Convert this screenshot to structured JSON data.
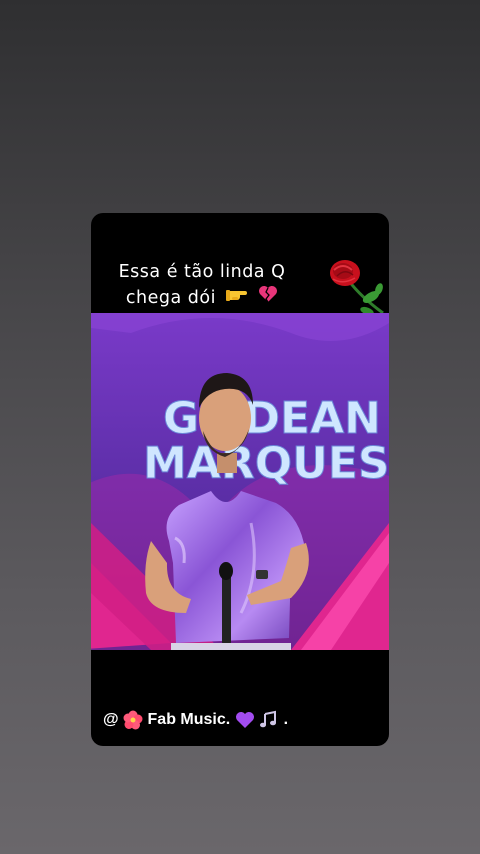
{
  "story": {
    "caption_line1": "Essa é tão linda Q",
    "caption_line2": "chega dói",
    "caption_emojis": [
      "pointing-hand-icon",
      "broken-heart-icon"
    ],
    "sticker": "rose-icon",
    "video_stage_text": [
      "GILDEAN",
      "MARQUES"
    ],
    "footer_at": "@",
    "footer_name": "Fab Music.",
    "footer_suffix": ".",
    "footer_emojis": [
      "hibiscus-icon",
      "purple-heart-icon",
      "music-notes-icon"
    ]
  },
  "colors": {
    "background_top": "#2f2f31",
    "background_bottom": "#6a676b",
    "card": "#000000",
    "stage_purple": "#5a2ea0",
    "stage_pink": "#e0268f",
    "text": "#ffffff"
  }
}
